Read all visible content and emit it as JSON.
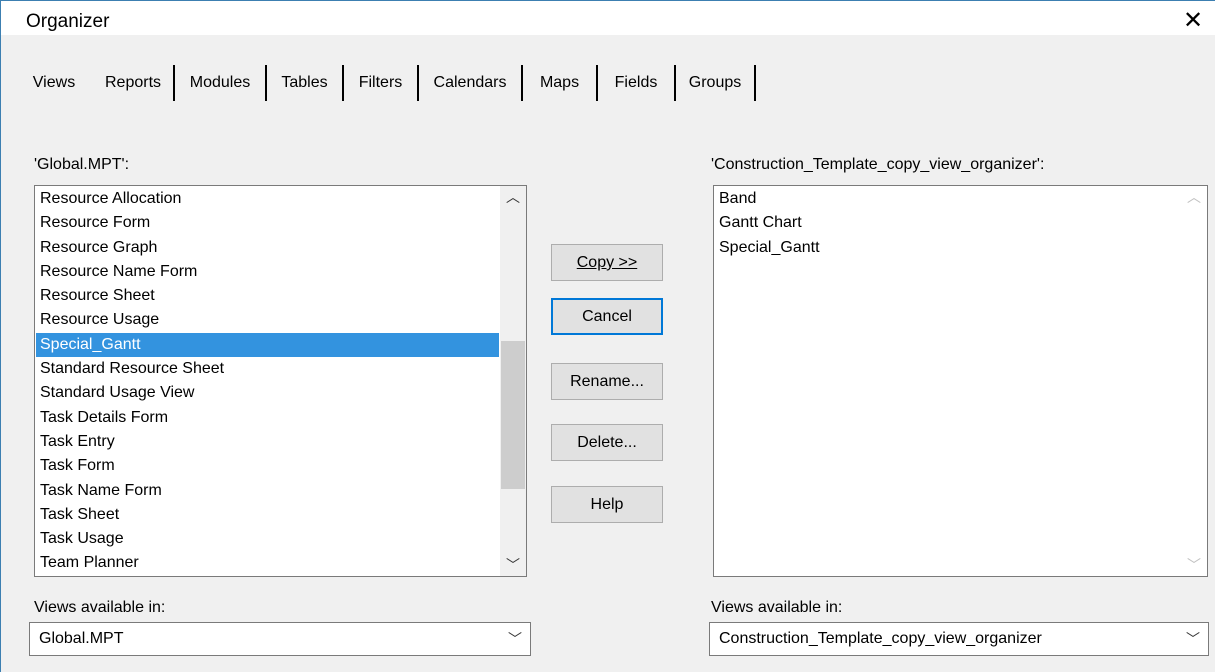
{
  "title": "Organizer",
  "tabs": [
    "Views",
    "Reports",
    "Modules",
    "Tables",
    "Filters",
    "Calendars",
    "Maps",
    "Fields",
    "Groups"
  ],
  "active_tab": "Views",
  "left": {
    "label": "'Global.MPT':",
    "items": [
      "Resource Allocation",
      "Resource Form",
      "Resource Graph",
      "Resource Name Form",
      "Resource Sheet",
      "Resource Usage",
      "Special_Gantt",
      "Standard Resource Sheet",
      "Standard Usage View",
      "Task Details Form",
      "Task Entry",
      "Task Form",
      "Task Name Form",
      "Task Sheet",
      "Task Usage",
      "Team Planner"
    ],
    "selected": "Special_Gantt",
    "available_label": "Views available in:",
    "available_value": "Global.MPT"
  },
  "right": {
    "label": "'Construction_Template_copy_view_organizer':",
    "items": [
      "Band",
      "Gantt Chart",
      "Special_Gantt"
    ],
    "available_label": "Views available in:",
    "available_value": "Construction_Template_copy_view_organizer"
  },
  "buttons": {
    "copy": "Copy >>",
    "cancel": "Cancel",
    "rename": "Rename...",
    "delete": "Delete...",
    "help": "Help"
  },
  "icons": {
    "close": "close-icon",
    "scroll_up": "chevron-up-icon",
    "scroll_down": "chevron-down-icon",
    "dropdown": "chevron-down-icon"
  }
}
